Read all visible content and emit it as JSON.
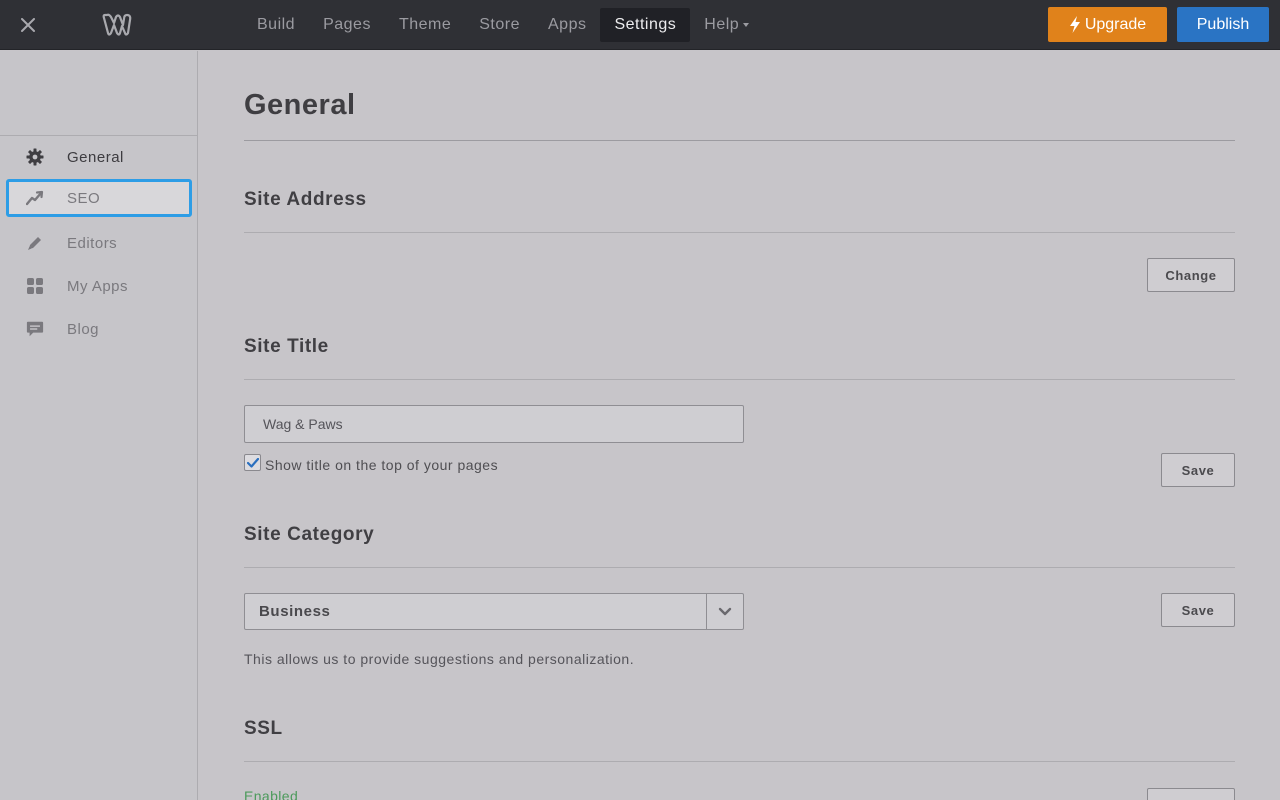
{
  "topbar": {
    "nav": [
      {
        "label": "Build",
        "icon": ""
      },
      {
        "label": "Pages",
        "icon": ""
      },
      {
        "label": "Theme",
        "icon": ""
      },
      {
        "label": "Store",
        "icon": ""
      },
      {
        "label": "Apps",
        "icon": ""
      },
      {
        "label": "Settings",
        "icon": ""
      },
      {
        "label": "Help",
        "icon": "caret-down-icon"
      }
    ],
    "active_tab": "Settings",
    "upgrade_label": "Upgrade",
    "publish_label": "Publish",
    "colors": {
      "bar": "#2f3035",
      "upgrade": "#e0821b",
      "publish": "#2a74c4"
    }
  },
  "sidebar": {
    "items": [
      {
        "label": "General",
        "icon": "gear-icon"
      },
      {
        "label": "SEO",
        "icon": "trend-icon"
      },
      {
        "label": "Editors",
        "icon": "pencil-icon"
      },
      {
        "label": "My Apps",
        "icon": "grid-icon"
      },
      {
        "label": "Blog",
        "icon": "comment-icon"
      }
    ],
    "focused_item": "SEO",
    "focus_color": "#2d9de6"
  },
  "main": {
    "page_title": "General",
    "site_address": {
      "title": "Site Address",
      "change_label": "Change"
    },
    "site_title": {
      "title": "Site Title",
      "input_value": "Wag & Paws",
      "show_title_checked": true,
      "show_title_label": "Show title on the top of your pages",
      "save_label": "Save"
    },
    "site_category": {
      "title": "Site Category",
      "selected": "Business",
      "save_label": "Save",
      "help": "This allows us to provide suggestions and personalization."
    },
    "ssl": {
      "title": "SSL",
      "status": "Enabled",
      "status_color": "#4c9a5b"
    }
  }
}
